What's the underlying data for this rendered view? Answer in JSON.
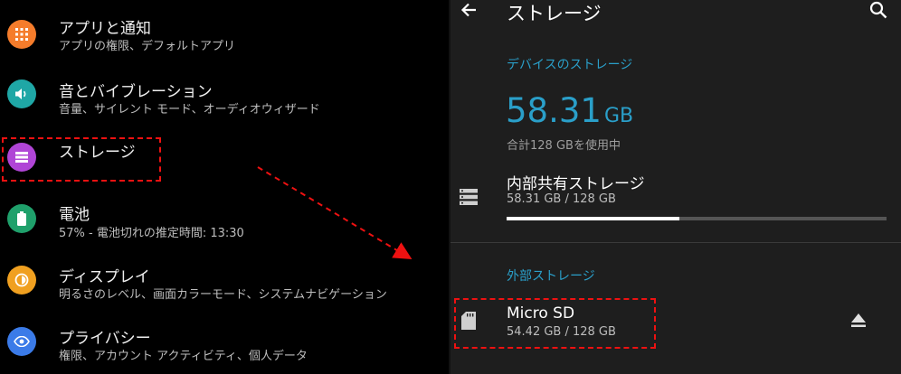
{
  "settings": {
    "items": [
      {
        "title": "アプリと通知",
        "subtitle": "アプリの権限、デフォルトアプリ",
        "icon": "apps-grid-icon",
        "color": "#f57c2b"
      },
      {
        "title": "音とバイブレーション",
        "subtitle": "音量、サイレント モード、オーディオウィザード",
        "icon": "volume-icon",
        "color": "#1fa7a6"
      },
      {
        "title": "ストレージ",
        "subtitle": "",
        "icon": "storage-icon",
        "color": "#b045d6"
      },
      {
        "title": "電池",
        "subtitle": "57% - 電池切れの推定時間: 13:30",
        "icon": "battery-icon",
        "color": "#1fa06b"
      },
      {
        "title": "ディスプレイ",
        "subtitle": "明るさのレベル、画面カラーモード、システムナビゲーション",
        "icon": "display-brightness-icon",
        "color": "#f0a020"
      },
      {
        "title": "プライバシー",
        "subtitle": "権限、アカウント アクティビティ、個人データ",
        "icon": "privacy-eye-icon",
        "color": "#3b7be8"
      }
    ]
  },
  "storage": {
    "title": "ストレージ",
    "device_header": "デバイスのストレージ",
    "used_value": "58.31",
    "used_unit": "GB",
    "total_text": "合計128 GBを使用中",
    "internal": {
      "title": "内部共有ストレージ",
      "subtitle": "58.31 GB / 128 GB",
      "usage": 0.455
    },
    "external_header": "外部ストレージ",
    "sd": {
      "title": "Micro SD",
      "subtitle": "54.42 GB / 128 GB"
    }
  },
  "colors": {
    "accent": "#2a9fc9",
    "highlight": "#e11111"
  }
}
